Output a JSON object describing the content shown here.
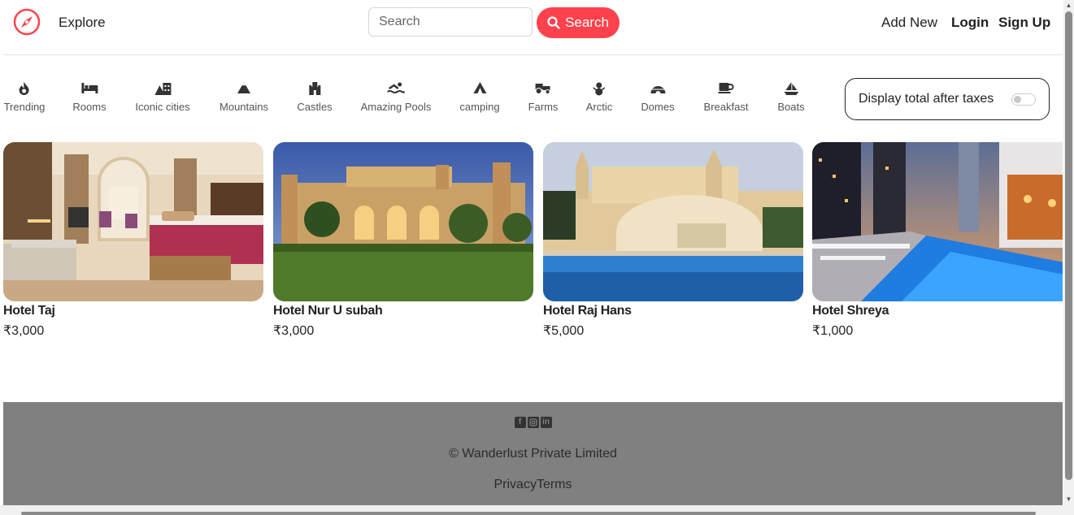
{
  "nav": {
    "explore": "Explore",
    "search_placeholder": "Search",
    "search_button": "Search",
    "add_new": "Add New",
    "login": "Login",
    "signup": "Sign Up",
    "accent": "#fe424d"
  },
  "filters": [
    {
      "label": "Trending",
      "icon": "fire-icon"
    },
    {
      "label": "Rooms",
      "icon": "bed-icon"
    },
    {
      "label": "Iconic cities",
      "icon": "city-icon"
    },
    {
      "label": "Mountains",
      "icon": "mountain-icon"
    },
    {
      "label": "Castles",
      "icon": "castle-icon"
    },
    {
      "label": "Amazing Pools",
      "icon": "swimmer-icon"
    },
    {
      "label": "camping",
      "icon": "tent-icon"
    },
    {
      "label": "Farms",
      "icon": "tractor-icon"
    },
    {
      "label": "Arctic",
      "icon": "snowman-icon"
    },
    {
      "label": "Domes",
      "icon": "igloo-icon"
    },
    {
      "label": "Breakfast",
      "icon": "mug-icon"
    },
    {
      "label": "Boats",
      "icon": "sailboat-icon"
    }
  ],
  "tax_toggle": {
    "label": "Display total after taxes",
    "checked": false
  },
  "listings": [
    {
      "title": "Hotel Taj",
      "price": "₹3,000"
    },
    {
      "title": "Hotel Nur U subah",
      "price": "₹3,000"
    },
    {
      "title": "Hotel Raj Hans",
      "price": "₹5,000"
    },
    {
      "title": "Hotel Shreya",
      "price": "₹1,000"
    }
  ],
  "footer": {
    "socials": [
      "facebook-icon",
      "instagram-icon",
      "linkedin-icon"
    ],
    "copyright": "© Wanderlust Private Limited",
    "privacy": "Privacy",
    "terms": "Terms"
  }
}
